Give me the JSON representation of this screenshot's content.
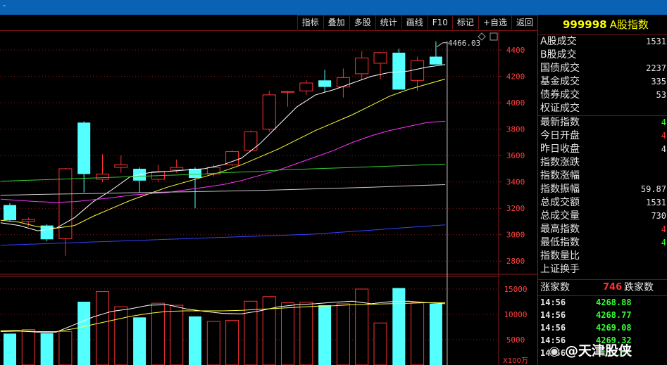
{
  "window": {
    "title_fragment": "-"
  },
  "toolbar": {
    "buttons": [
      "指标",
      "叠加",
      "多股",
      "统计",
      "画线",
      "F10",
      "标记",
      "+自选",
      "返回"
    ]
  },
  "colors": {
    "up": "#ff3232",
    "down": "#54ffff",
    "ma5": "#ffffff",
    "ma10": "#ffff33",
    "ma20": "#ff33ff",
    "ma60": "#33cc33",
    "ma120": "#c8c8c8",
    "ma250": "#3344ff",
    "grid": "#8a1a1a"
  },
  "chart": {
    "max_label": "4466.03",
    "price_axis": [
      "4400",
      "4200",
      "4000",
      "3800",
      "3600",
      "3400",
      "3200",
      "3000",
      "2800"
    ],
    "volume_axis": [
      "15000",
      "10000",
      "5000"
    ],
    "volume_unit": "X100万"
  },
  "chart_data": {
    "type": "candlestick",
    "price_ylim": [
      2700,
      4550
    ],
    "volume_ylim": [
      0,
      17500
    ],
    "candles": [
      {
        "o": 3225,
        "h": 3240,
        "l": 3100,
        "c": 3110,
        "v": 6200
      },
      {
        "o": 3100,
        "h": 3130,
        "l": 3060,
        "c": 3115,
        "v": 7000
      },
      {
        "o": 3070,
        "h": 3080,
        "l": 2950,
        "c": 2965,
        "v": 6300
      },
      {
        "o": 2970,
        "h": 3505,
        "l": 2840,
        "c": 3500,
        "v": 6600
      },
      {
        "o": 3850,
        "h": 3860,
        "l": 3320,
        "c": 3460,
        "v": 12500
      },
      {
        "o": 3420,
        "h": 3610,
        "l": 3400,
        "c": 3460,
        "v": 14500
      },
      {
        "o": 3510,
        "h": 3600,
        "l": 3470,
        "c": 3530,
        "v": 11500
      },
      {
        "o": 3500,
        "h": 3510,
        "l": 3320,
        "c": 3410,
        "v": 9400
      },
      {
        "o": 3420,
        "h": 3530,
        "l": 3400,
        "c": 3480,
        "v": 12200
      },
      {
        "o": 3490,
        "h": 3570,
        "l": 3470,
        "c": 3510,
        "v": 11800
      },
      {
        "o": 3500,
        "h": 3510,
        "l": 3200,
        "c": 3430,
        "v": 9600
      },
      {
        "o": 3460,
        "h": 3530,
        "l": 3440,
        "c": 3510,
        "v": 8600
      },
      {
        "o": 3530,
        "h": 3640,
        "l": 3520,
        "c": 3630,
        "v": 8800
      },
      {
        "o": 3640,
        "h": 3790,
        "l": 3630,
        "c": 3780,
        "v": 12600
      },
      {
        "o": 3800,
        "h": 4090,
        "l": 3780,
        "c": 4060,
        "v": 13500
      },
      {
        "o": 4080,
        "h": 4090,
        "l": 3970,
        "c": 4085,
        "v": 12300
      },
      {
        "o": 4090,
        "h": 4170,
        "l": 4060,
        "c": 4150,
        "v": 12400
      },
      {
        "o": 4170,
        "h": 4250,
        "l": 4080,
        "c": 4120,
        "v": 11800
      },
      {
        "o": 4120,
        "h": 4260,
        "l": 4040,
        "c": 4190,
        "v": 12100
      },
      {
        "o": 4220,
        "h": 4390,
        "l": 4170,
        "c": 4340,
        "v": 15000
      },
      {
        "o": 4300,
        "h": 4385,
        "l": 4180,
        "c": 4380,
        "v": 8300
      },
      {
        "o": 4380,
        "h": 4410,
        "l": 4140,
        "c": 4100,
        "v": 15200
      },
      {
        "o": 4170,
        "h": 4350,
        "l": 4090,
        "c": 4320,
        "v": 12300
      },
      {
        "o": 4350,
        "h": 4466,
        "l": 4290,
        "c": 4290,
        "v": 12100
      }
    ],
    "ma_lines": [
      {
        "key": "ma5",
        "values": [
          3090,
          3070,
          3030,
          3050,
          3130,
          3250,
          3340,
          3440,
          3470,
          3480,
          3490,
          3500,
          3530,
          3580,
          3690,
          3830,
          3970,
          4060,
          4100,
          4150,
          4200,
          4230,
          4240,
          4270,
          4290
        ]
      },
      {
        "key": "ma10",
        "values": [
          3110,
          3095,
          3060,
          3050,
          3070,
          3140,
          3200,
          3260,
          3310,
          3360,
          3400,
          3440,
          3480,
          3530,
          3590,
          3650,
          3720,
          3790,
          3850,
          3910,
          3980,
          4050,
          4100,
          4140,
          4180
        ]
      },
      {
        "key": "ma20",
        "values": [
          3270,
          3260,
          3250,
          3245,
          3250,
          3265,
          3280,
          3300,
          3310,
          3320,
          3340,
          3360,
          3380,
          3410,
          3450,
          3490,
          3540,
          3590,
          3640,
          3700,
          3750,
          3790,
          3820,
          3850,
          3860
        ]
      },
      {
        "key": "ma60",
        "values": [
          3405,
          3410,
          3415,
          3420,
          3425,
          3430,
          3435,
          3440,
          3445,
          3450,
          3455,
          3460,
          3470,
          3475,
          3480,
          3490,
          3495,
          3500,
          3505,
          3510,
          3515,
          3520,
          3525,
          3530,
          3535
        ]
      },
      {
        "key": "ma120",
        "values": [
          3300,
          3302,
          3305,
          3308,
          3310,
          3312,
          3315,
          3318,
          3320,
          3323,
          3325,
          3328,
          3330,
          3333,
          3336,
          3340,
          3344,
          3348,
          3352,
          3356,
          3360,
          3365,
          3370,
          3375,
          3380
        ]
      },
      {
        "key": "ma250",
        "values": [
          2920,
          2925,
          2930,
          2935,
          2940,
          2945,
          2950,
          2955,
          2960,
          2965,
          2970,
          2975,
          2980,
          2985,
          2990,
          2995,
          3000,
          3005,
          3015,
          3025,
          3035,
          3045,
          3055,
          3065,
          3075
        ]
      }
    ],
    "vol_ma": [
      {
        "key": "ma5",
        "values": [
          6600,
          6700,
          6500,
          6500,
          8000,
          9500,
          10600,
          11100,
          11800,
          11900,
          11100,
          10600,
          10200,
          10100,
          10700,
          11500,
          11900,
          12100,
          12400,
          12600,
          12100,
          12500,
          12600,
          12300,
          12100
        ]
      },
      {
        "key": "ma10",
        "values": [
          6800,
          6800,
          6600,
          6600,
          7200,
          8000,
          8800,
          9600,
          10200,
          10600,
          10700,
          10700,
          10700,
          10800,
          11000,
          11200,
          11400,
          11600,
          11700,
          11900,
          12000,
          12100,
          12200,
          12300,
          12300
        ]
      }
    ]
  },
  "sidebar": {
    "code": "999998",
    "name": "A股指数",
    "stats": [
      {
        "label": "A股成交",
        "value": "1531",
        "color": "#e6e6e6"
      },
      {
        "label": "B股成交",
        "value": "",
        "color": "#e6e6e6"
      },
      {
        "label": "国债成交",
        "value": "2237",
        "color": "#e6e6e6"
      },
      {
        "label": "基金成交",
        "value": "335",
        "color": "#e6e6e6"
      },
      {
        "label": "债券成交",
        "value": "53",
        "color": "#e6e6e6"
      },
      {
        "label": "权证成交",
        "value": "",
        "color": "#e6e6e6"
      }
    ],
    "quotes": [
      {
        "label": "最新指数",
        "value": "4",
        "color": "#33ff33"
      },
      {
        "label": "今日开盘",
        "value": "4",
        "color": "#ff3232"
      },
      {
        "label": "昨日收盘",
        "value": "4",
        "color": "#e6e6e6"
      },
      {
        "label": "指数涨跌",
        "value": "",
        "color": "#33ff33"
      },
      {
        "label": "指数涨幅",
        "value": "",
        "color": "#33ff33"
      },
      {
        "label": "指数振幅",
        "value": "59.87",
        "color": "#e6e6e6"
      },
      {
        "label": "总成交额",
        "value": "1531",
        "color": "#e6e6e6"
      },
      {
        "label": "总成交量",
        "value": "730",
        "color": "#e6e6e6"
      },
      {
        "label": "最高指数",
        "value": "4",
        "color": "#ff3232"
      },
      {
        "label": "最低指数",
        "value": "4",
        "color": "#33ff33"
      },
      {
        "label": "指数量比",
        "value": "",
        "color": "#e6e6e6"
      },
      {
        "label": "上证换手",
        "value": "",
        "color": "#e6e6e6"
      }
    ],
    "counts": {
      "rise_label": "涨家数",
      "rise_value": "746",
      "fall_label": "跌家数"
    },
    "ticks": [
      {
        "time": "14:56",
        "price": "4268.88"
      },
      {
        "time": "14:56",
        "price": "4268.77"
      },
      {
        "time": "14:56",
        "price": "4269.08"
      },
      {
        "time": "14:56",
        "price": "4269.32"
      },
      {
        "time": "14:56",
        "price": "4268.91"
      }
    ]
  },
  "watermark": {
    "text": "@天津股侠"
  }
}
